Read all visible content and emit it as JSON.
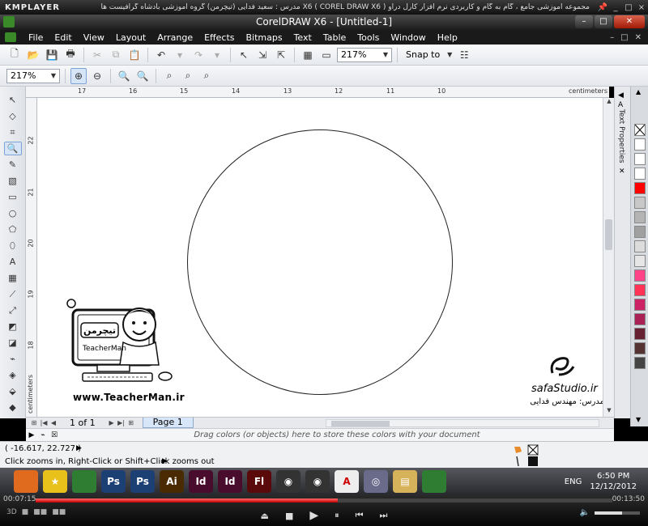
{
  "km_player": {
    "logo": "KMPLAYER",
    "title": "مجموعه آموزشی جامع ، گام به گام و کاربردی نرم افزار کارل دراو X6 ( COREL DRAW X6 )    مدرس : سعید فدایی (تیچرمن) گروه آموزشی بادشاه گرافیست ها",
    "pin_icon": "pin-icon",
    "win_buttons": [
      "_",
      "□",
      "×"
    ]
  },
  "window": {
    "title": "CorelDRAW X6 - [Untitled-1]",
    "buttons": [
      "–",
      "□",
      "✕"
    ]
  },
  "menu": {
    "items": [
      "File",
      "Edit",
      "View",
      "Layout",
      "Arrange",
      "Effects",
      "Bitmaps",
      "Text",
      "Table",
      "Tools",
      "Window",
      "Help"
    ],
    "right": [
      "–",
      "□",
      "✕"
    ]
  },
  "standard_toolbar": {
    "zoom_value": "217%",
    "snap_label": "Snap to"
  },
  "property_bar": {
    "zoom_value": "217%"
  },
  "rulers": {
    "top_labels": [
      "17",
      "16",
      "15",
      "14",
      "13",
      "12",
      "11",
      "10"
    ],
    "left_labels": [
      "22",
      "21",
      "20",
      "19",
      "18"
    ],
    "unit": "centimeters"
  },
  "docker": {
    "label": "Text Properties"
  },
  "canvas": {
    "teacher_url": "www.TeacherMan.ir",
    "teacher_logo_text": "TeacherMan",
    "teacher_logo_fa": "تیچرمن",
    "safa_name": "safaStudio.ir",
    "safa_teacher": "مدرس: مهندس فدایی"
  },
  "navigator": {
    "page_count": "1 of 1",
    "page_tab": "Page 1"
  },
  "doc_palette": {
    "hint": "Drag colors (or objects) here to store these colors with your document"
  },
  "status": {
    "coords": "( -16.617, 22.727 )",
    "hint": "Click zooms in, Right-Click or Shift+Click zooms out"
  },
  "palette_colors": [
    "#ffffff",
    "#ffffff",
    "#ffffff",
    "#ff0000",
    "#c8c8c8",
    "#b4b4b4",
    "#a0a0a0",
    "#dcdcdc",
    "#e6e6e6",
    "#ff4488",
    "#ff3355",
    "#cc2266",
    "#aa2255",
    "#662233",
    "#553333",
    "#444444"
  ],
  "taskbar": {
    "icons": [
      {
        "name": "firefox-icon",
        "label": "",
        "color": "#e06b1f"
      },
      {
        "name": "star-icon",
        "label": "★",
        "color": "#e8c21a"
      },
      {
        "name": "coreldraw-icon",
        "label": "",
        "color": "#2e7d32"
      },
      {
        "name": "photoshop-icon",
        "label": "Ps",
        "color": "#1c3f74"
      },
      {
        "name": "photoshop2-icon",
        "label": "Ps",
        "color": "#1c3f74"
      },
      {
        "name": "illustrator-icon",
        "label": "Ai",
        "color": "#4a2a00"
      },
      {
        "name": "indesign-icon",
        "label": "Id",
        "color": "#4a0c2c"
      },
      {
        "name": "indesign2-icon",
        "label": "Id",
        "color": "#4a0c2c"
      },
      {
        "name": "flash-icon",
        "label": "Fl",
        "color": "#5a0a0a"
      },
      {
        "name": "app-icon-1",
        "label": "◉",
        "color": "#333"
      },
      {
        "name": "app-icon-2",
        "label": "◉",
        "color": "#333"
      },
      {
        "name": "acrobat-icon",
        "label": "A",
        "color": "#eeeeee"
      },
      {
        "name": "disc-icon",
        "label": "◎",
        "color": "#6a6a8a"
      },
      {
        "name": "folder-icon",
        "label": "▤",
        "color": "#d6b25a"
      },
      {
        "name": "coreldraw-active-icon",
        "label": "",
        "color": "#2e7d32"
      }
    ],
    "lang": "ENG",
    "time": "6:50 PM",
    "date": "12/12/2012"
  },
  "player": {
    "elapsed": "00:07:15",
    "total": "00:13:50",
    "progress": 0.524,
    "volume": 0.6,
    "left_labels": [
      "3D",
      "■",
      "■■",
      "■■"
    ]
  }
}
